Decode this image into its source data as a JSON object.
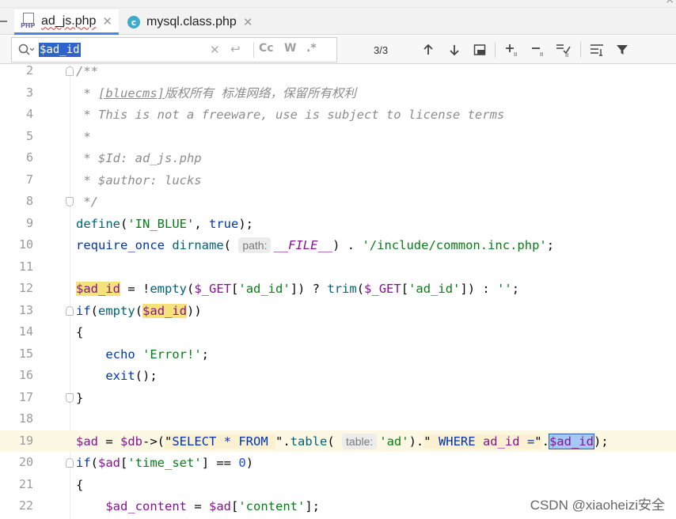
{
  "tabs": [
    {
      "label": "ad_js.php",
      "icon": "php-file-icon",
      "active": true
    },
    {
      "label": "mysql.class.php",
      "icon": "class-file-icon",
      "active": false
    }
  ],
  "search": {
    "query": "$ad_id",
    "match_count": "3/3",
    "options": [
      "Cc",
      "W",
      ".*"
    ]
  },
  "code_lines": [
    {
      "n": "2"
    },
    {
      "n": "3"
    },
    {
      "n": "4"
    },
    {
      "n": "5"
    },
    {
      "n": "6"
    },
    {
      "n": "7"
    },
    {
      "n": "8"
    },
    {
      "n": "9"
    },
    {
      "n": "10"
    },
    {
      "n": "11"
    },
    {
      "n": "12"
    },
    {
      "n": "13"
    },
    {
      "n": "14"
    },
    {
      "n": "15"
    },
    {
      "n": "16"
    },
    {
      "n": "17"
    },
    {
      "n": "18"
    },
    {
      "n": "19"
    },
    {
      "n": "20"
    },
    {
      "n": "21"
    },
    {
      "n": "22"
    }
  ],
  "code": {
    "l2": "/**",
    "l3_tag": "[bluecms]",
    "l3_rest": "版权所有 标准网络，保留所有权利",
    "l4": " * This is not a freeware, use is subject to license terms",
    "l5": " *",
    "l6": " * $Id: ad_js.php",
    "l7": " * $author: lucks",
    "l8": " */",
    "l9_fn": "define",
    "l9_str": "'IN_BLUE'",
    "l9_kw": "true",
    "l10_kw": "require_once",
    "l10_fn": "dirname",
    "l10_hint": "path:",
    "l10_const": "__FILE__",
    "l10_str": "'/include/common.inc.php'",
    "l12_var": "$ad_id",
    "l12_fn1": "empty",
    "l12_get": "$_GET",
    "l12_key": "'ad_id'",
    "l12_fn2": "trim",
    "l12_empty": "''",
    "l13_kw": "if",
    "l13_fn": "empty",
    "l13_var": "$ad_id",
    "l15_kw": "echo",
    "l15_str": "'Error!'",
    "l16_kw": "exit",
    "l19_var1": "$ad",
    "l19_var2": "$db",
    "l19_sql1_kw": "SELECT * FROM ",
    "l19_fn": "table",
    "l19_hint": "table:",
    "l19_str": "'ad'",
    "l19_sql2_kw": "WHERE ",
    "l19_sql2_id": "ad_id",
    "l19_sql2_op": " =",
    "l19_var3": "$ad_id",
    "l20_kw": "if",
    "l20_var": "$ad",
    "l20_key": "'time_set'",
    "l20_num": "0",
    "l22_var1": "$ad_content",
    "l22_var2": "$ad",
    "l22_key": "'content'"
  },
  "watermark": "CSDN @xiaoheizi安全"
}
